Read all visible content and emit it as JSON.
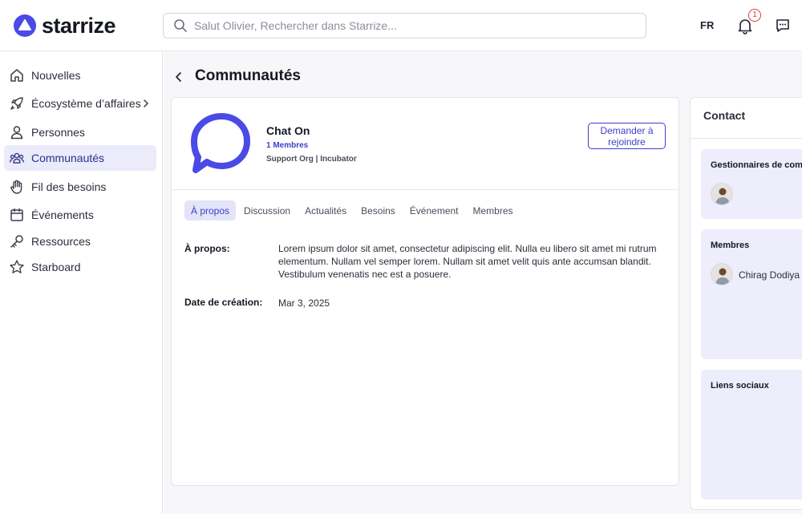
{
  "header": {
    "brand": "starrize",
    "search_placeholder": "Salut Olivier, Rechercher dans Starrize...",
    "language": "FR",
    "notification_count": "1"
  },
  "sidebar": {
    "items": [
      {
        "label": "Nouvelles",
        "icon": "home-icon"
      },
      {
        "label": "Écosystème d’affaires",
        "icon": "rocket-icon"
      },
      {
        "label": "Personnes",
        "icon": "person-icon"
      },
      {
        "label": "Communautés",
        "icon": "people-group-icon"
      },
      {
        "label": "Fil des besoins",
        "icon": "hand-icon"
      },
      {
        "label": "Événements",
        "icon": "calendar-icon"
      },
      {
        "label": "Ressources",
        "icon": "key-icon"
      },
      {
        "label": "Starboard",
        "icon": "star-icon"
      }
    ]
  },
  "page": {
    "title": "Communautés"
  },
  "community": {
    "name": "Chat On",
    "members": "1 Membres",
    "meta": "Support Org | Incubator",
    "join_label": "Demander à rejoindre"
  },
  "tabs": [
    "À propos",
    "Discussion",
    "Actualités",
    "Besoins",
    "Événement",
    "Membres"
  ],
  "about": {
    "about_label": "À propos:",
    "about_text": "Lorem ipsum dolor sit amet, consectetur adipiscing elit. Nulla eu libero sit amet mi rutrum elementum. Nullam vel semper lorem. Nullam sit amet velit quis ante accumsan blandit. Vestibulum venenatis nec est a posuere.",
    "date_label": "Date de création:",
    "date_value": "Mar 3, 2025"
  },
  "contact": {
    "title": "Contact",
    "managers_title": "Gestionnaires de communauté",
    "members_title": "Membres",
    "member_name": "Chirag Dodiya",
    "social_title": "Liens sociaux"
  },
  "colors": {
    "accent": "#3f3fc8",
    "brand": "#4a4ae6",
    "active_bg": "#ebebfb",
    "badge": "#e23b3b"
  }
}
